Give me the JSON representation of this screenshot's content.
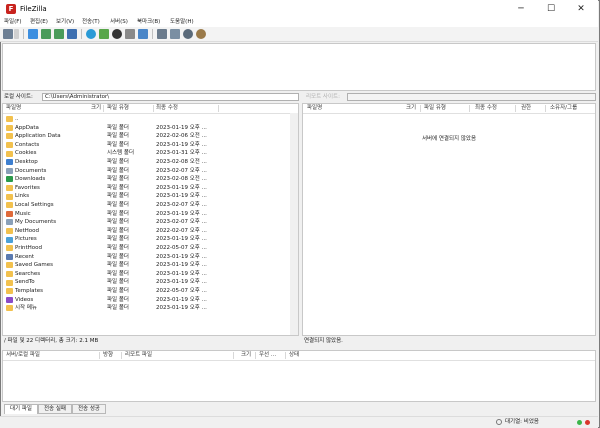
{
  "window": {
    "title": "FileZilla",
    "app_icon_letter": "F",
    "controls": {
      "minimize": "─",
      "maximize": "☐",
      "close": "✕"
    }
  },
  "menu": [
    "파일(F)",
    "편집(E)",
    "보기(V)",
    "전송(T)",
    "서버(S)",
    "북마크(B)",
    "도움말(H)"
  ],
  "toolbar_icons": [
    "site-manager-icon",
    "site-manager-dropdown-icon",
    "toggle-message-log-icon",
    "toggle-local-tree-icon",
    "toggle-remote-tree-icon",
    "toggle-queue-icon",
    "refresh-icon",
    "process-queue-icon",
    "cancel-icon",
    "disconnect-icon",
    "reconnect-icon",
    "directory-filter-icon",
    "toggle-sync-browsing-icon",
    "search-icon",
    "compare-icon"
  ],
  "local": {
    "path_label": "로컬 사이트:",
    "path_value": "C:\\Users\\Administrator\\",
    "columns": {
      "name": "파일명",
      "size": "크기",
      "type": "파일 유형",
      "modified": "최종 수정"
    },
    "files": [
      {
        "name": "..",
        "type": "",
        "modified": "",
        "icon": "folder"
      },
      {
        "name": "AppData",
        "type": "파일 폴더",
        "modified": "2023-01-19 오후 ...",
        "icon": "folder"
      },
      {
        "name": "Application Data",
        "type": "파일 폴더",
        "modified": "2022-02-06 오전 ...",
        "icon": "folder"
      },
      {
        "name": "Contacts",
        "type": "파일 폴더",
        "modified": "2023-01-19 오후 ...",
        "icon": "folder"
      },
      {
        "name": "Cookies",
        "type": "시스템 폴더",
        "modified": "2023-01-31 오후 ...",
        "icon": "folder"
      },
      {
        "name": "Desktop",
        "type": "파일 폴더",
        "modified": "2023-02-08 오전 ...",
        "icon": "desktop"
      },
      {
        "name": "Documents",
        "type": "파일 폴더",
        "modified": "2023-02-07 오후 ...",
        "icon": "documents"
      },
      {
        "name": "Downloads",
        "type": "파일 폴더",
        "modified": "2023-02-08 오전 ...",
        "icon": "downloads"
      },
      {
        "name": "Favorites",
        "type": "파일 폴더",
        "modified": "2023-01-19 오후 ...",
        "icon": "folder"
      },
      {
        "name": "Links",
        "type": "파일 폴더",
        "modified": "2023-01-19 오후 ...",
        "icon": "folder"
      },
      {
        "name": "Local Settings",
        "type": "파일 폴더",
        "modified": "2023-02-07 오후 ...",
        "icon": "folder"
      },
      {
        "name": "Music",
        "type": "파일 폴더",
        "modified": "2023-01-19 오후 ...",
        "icon": "music"
      },
      {
        "name": "My Documents",
        "type": "파일 폴더",
        "modified": "2023-02-07 오후 ...",
        "icon": "documents"
      },
      {
        "name": "NetHood",
        "type": "파일 폴더",
        "modified": "2022-02-07 오후 ...",
        "icon": "folder"
      },
      {
        "name": "Pictures",
        "type": "파일 폴더",
        "modified": "2023-01-19 오후 ...",
        "icon": "pictures"
      },
      {
        "name": "PrintHood",
        "type": "파일 폴더",
        "modified": "2022-05-07 오후 ...",
        "icon": "folder"
      },
      {
        "name": "Recent",
        "type": "파일 폴더",
        "modified": "2023-01-19 오후 ...",
        "icon": "recent"
      },
      {
        "name": "Saved Games",
        "type": "파일 폴더",
        "modified": "2023-01-19 오후 ...",
        "icon": "folder"
      },
      {
        "name": "Searches",
        "type": "파일 폴더",
        "modified": "2023-01-19 오후 ...",
        "icon": "folder"
      },
      {
        "name": "SendTo",
        "type": "파일 폴더",
        "modified": "2023-01-19 오후 ...",
        "icon": "folder"
      },
      {
        "name": "Templates",
        "type": "파일 폴더",
        "modified": "2022-05-07 오후 ...",
        "icon": "folder"
      },
      {
        "name": "Videos",
        "type": "파일 폴더",
        "modified": "2023-01-19 오후 ...",
        "icon": "videos"
      },
      {
        "name": "시작 메뉴",
        "type": "파일 폴더",
        "modified": "2023-01-19 오후 ...",
        "icon": "folder"
      }
    ],
    "status": "/ 파일 및 22 디렉터리, 총 크기: 2.1 MB"
  },
  "remote": {
    "path_label": "리모트 사이트:",
    "path_value": "",
    "columns": {
      "name": "파일명",
      "size": "크기",
      "type": "파일 유형",
      "modified": "최종 수정",
      "perm": "권한",
      "owner": "소유자/그룹"
    },
    "empty_message": "서버에 연결되지 않았음",
    "status": "연결되지 않았음."
  },
  "queue": {
    "columns": {
      "server": "서버/로컬 파일",
      "direction": "방향",
      "remote": "리모트 파일",
      "size": "크기",
      "priority": "우선 ...",
      "status": "상태"
    }
  },
  "tabs": [
    "대기 파일",
    "전송 실패",
    "전송 성공"
  ],
  "statusbar": {
    "queue_text": "대기열: 비었음"
  },
  "colors": {
    "folder": "#f2c14e",
    "accent_blue": "#2a6fd6",
    "led_green": "#3bb54a",
    "led_red": "#d9352b"
  }
}
